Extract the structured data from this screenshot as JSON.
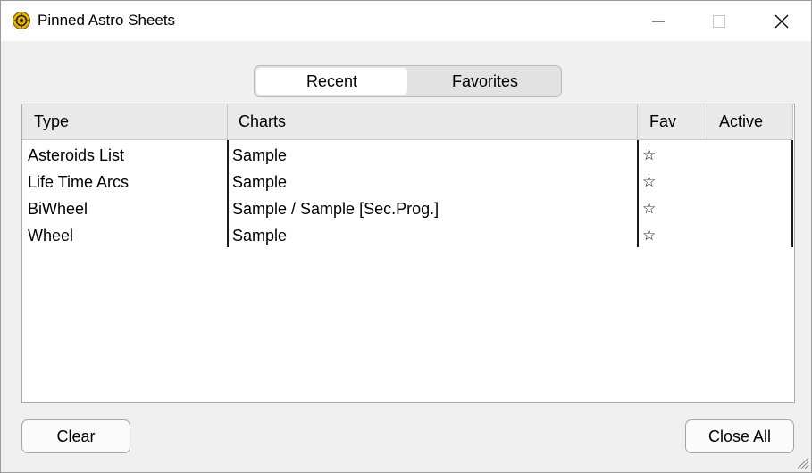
{
  "window": {
    "title": "Pinned Astro Sheets",
    "icon": "astro-app-icon"
  },
  "tabs": [
    {
      "label": "Recent",
      "selected": true
    },
    {
      "label": "Favorites",
      "selected": false
    }
  ],
  "table": {
    "columns": [
      "Type",
      "Charts",
      "Fav",
      "Active"
    ],
    "rows": [
      {
        "type": "Asteroids List",
        "charts": "Sample",
        "fav": "☆",
        "active": ""
      },
      {
        "type": "Life Time Arcs",
        "charts": "Sample",
        "fav": "☆",
        "active": ""
      },
      {
        "type": "BiWheel",
        "charts": "Sample / Sample [Sec.Prog.]",
        "fav": "☆",
        "active": ""
      },
      {
        "type": "Wheel",
        "charts": "Sample",
        "fav": "☆",
        "active": ""
      }
    ]
  },
  "buttons": {
    "clear": "Clear",
    "close_all": "Close All"
  },
  "colors": {
    "window_bg": "#f0f0f0",
    "titlebar_bg": "#ffffff",
    "icon_gold": "#e8b400"
  }
}
